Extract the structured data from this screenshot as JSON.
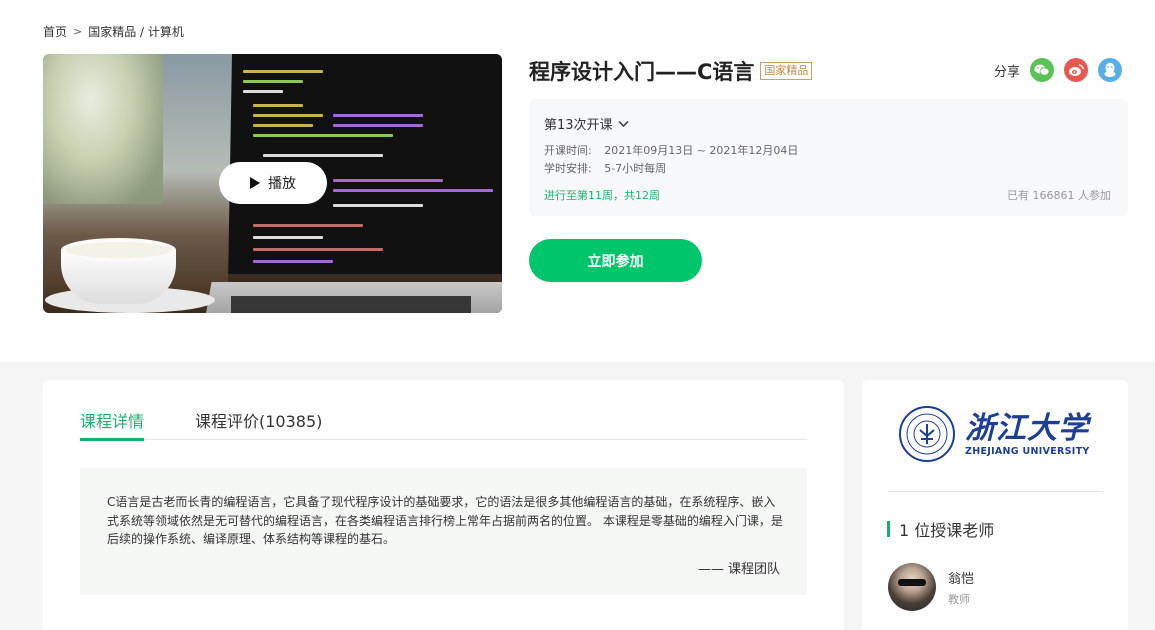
{
  "breadcrumb": {
    "home": "首页",
    "separator": ">",
    "path": "国家精品 / 计算机"
  },
  "video": {
    "play_label": "播放"
  },
  "course": {
    "title": "程序设计入门——C语言",
    "badge": "国家精品"
  },
  "share": {
    "label": "分享",
    "icons": [
      "wechat-icon",
      "weibo-icon",
      "qq-icon"
    ]
  },
  "session": {
    "term": "第13次开课",
    "start_label": "开课时间:",
    "start_value": "2021年09月13日 ~ 2021年12月04日",
    "schedule_label": "学时安排:",
    "schedule_value": "5-7小时每周",
    "progress": "进行至第11周，共12周",
    "joined": "已有 166861 人参加"
  },
  "join_button": "立即参加",
  "tabs": [
    {
      "label": "课程详情",
      "active": true
    },
    {
      "label": "课程评价(10385)",
      "active": false
    }
  ],
  "description": {
    "text": "C语言是古老而长青的编程语言，它具备了现代程序设计的基础要求，它的语法是很多其他编程语言的基础，在系统程序、嵌入式系统等领域依然是无可替代的编程语言，在各类编程语言排行榜上常年占据前两名的位置。 本课程是零基础的编程入门课，是后续的操作系统、编译原理、体系结构等课程的基石。",
    "signature": "—— 课程团队"
  },
  "university": {
    "name_cn": "浙江大学",
    "name_en": "ZHEJIANG UNIVERSITY"
  },
  "teachers": {
    "count_label": "1 位授课老师",
    "list": [
      {
        "name": "翁恺",
        "role": "教师"
      }
    ]
  },
  "colors": {
    "accent": "#00c56b",
    "accent_text": "#1ab06b",
    "badge_border": "#c9a26b",
    "university_blue": "#1c3f94"
  }
}
